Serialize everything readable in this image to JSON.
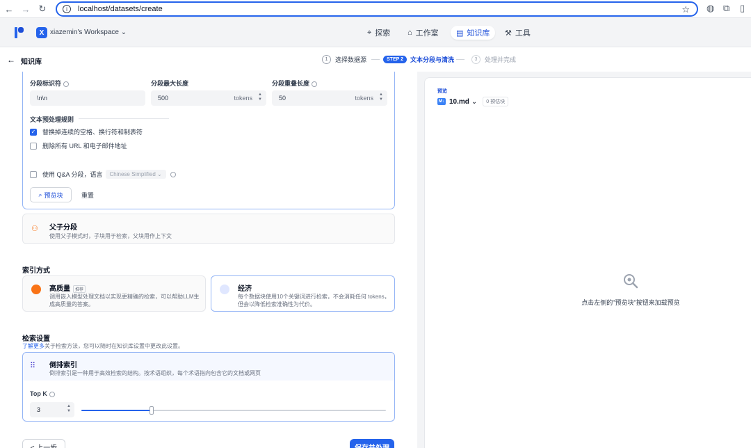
{
  "browser": {
    "url": "localhost/datasets/create"
  },
  "header": {
    "workspace_initial": "X",
    "workspace_name": "xiazemin's Workspace",
    "nav": [
      {
        "label": "探索"
      },
      {
        "label": "工作室"
      },
      {
        "label": "知识库"
      },
      {
        "label": "工具"
      }
    ]
  },
  "subheader": {
    "breadcrumb": "知识库",
    "steps": [
      {
        "num": "1",
        "label": "选择数据源"
      },
      {
        "num": "STEP 2",
        "label": "文本分段与清洗"
      },
      {
        "num": "3",
        "label": "处理并完成"
      }
    ]
  },
  "segment": {
    "separator_label": "分段标识符",
    "separator_value": "\\n\\n",
    "max_len_label": "分段最大长度",
    "max_len_value": "500",
    "max_len_unit": "tokens",
    "overlap_label": "分段重叠长度",
    "overlap_value": "50",
    "overlap_unit": "tokens",
    "rules_title": "文本预处理规则",
    "rule1": "替换掉连续的空格、换行符和制表符",
    "rule1_checked": true,
    "rule2": "删除所有 URL 和电子邮件地址",
    "rule2_checked": false,
    "qa_label": "使用 Q&A 分段，语言",
    "qa_lang": "Chinese Simplified",
    "preview_button": "预览块",
    "reset_button": "重置"
  },
  "parent_child": {
    "title": "父子分段",
    "desc": "使用父子模式时，子块用于检索，父块用作上下文"
  },
  "index": {
    "title": "索引方式",
    "high_title": "高质量",
    "high_badge": "推荐",
    "high_desc": "调用嵌入模型处理文档以实现更精确的检索，可以帮助LLM生成高质量的答案。",
    "eco_title": "经济",
    "eco_desc": "每个数据块使用10个关键词进行检索，不会消耗任何 tokens，但会以降低检索准确性为代价。"
  },
  "retrieval": {
    "title": "检索设置",
    "link_text": "了解更多",
    "link_rest": "关于检索方法，您可以随时在知识库设置中更改此设置。",
    "inv_title": "倒排索引",
    "inv_desc": "倒排索引是一种用于高效检索的结构。按术语组织，每个术语指向包含它的文档或网页",
    "topk_label": "Top K",
    "topk_value": "3",
    "topk_fraction": 0.23
  },
  "footer": {
    "prev": "< 上一步",
    "save": "保存并处理"
  },
  "preview": {
    "label": "预览",
    "file_icon": "M↓",
    "file": "10.md",
    "count": "0 预估块",
    "empty_text": "点击左侧的\"预览块\"按钮来加载预览"
  },
  "colors": {
    "accent": "#2563eb",
    "accent_light": "#93b4f5"
  }
}
